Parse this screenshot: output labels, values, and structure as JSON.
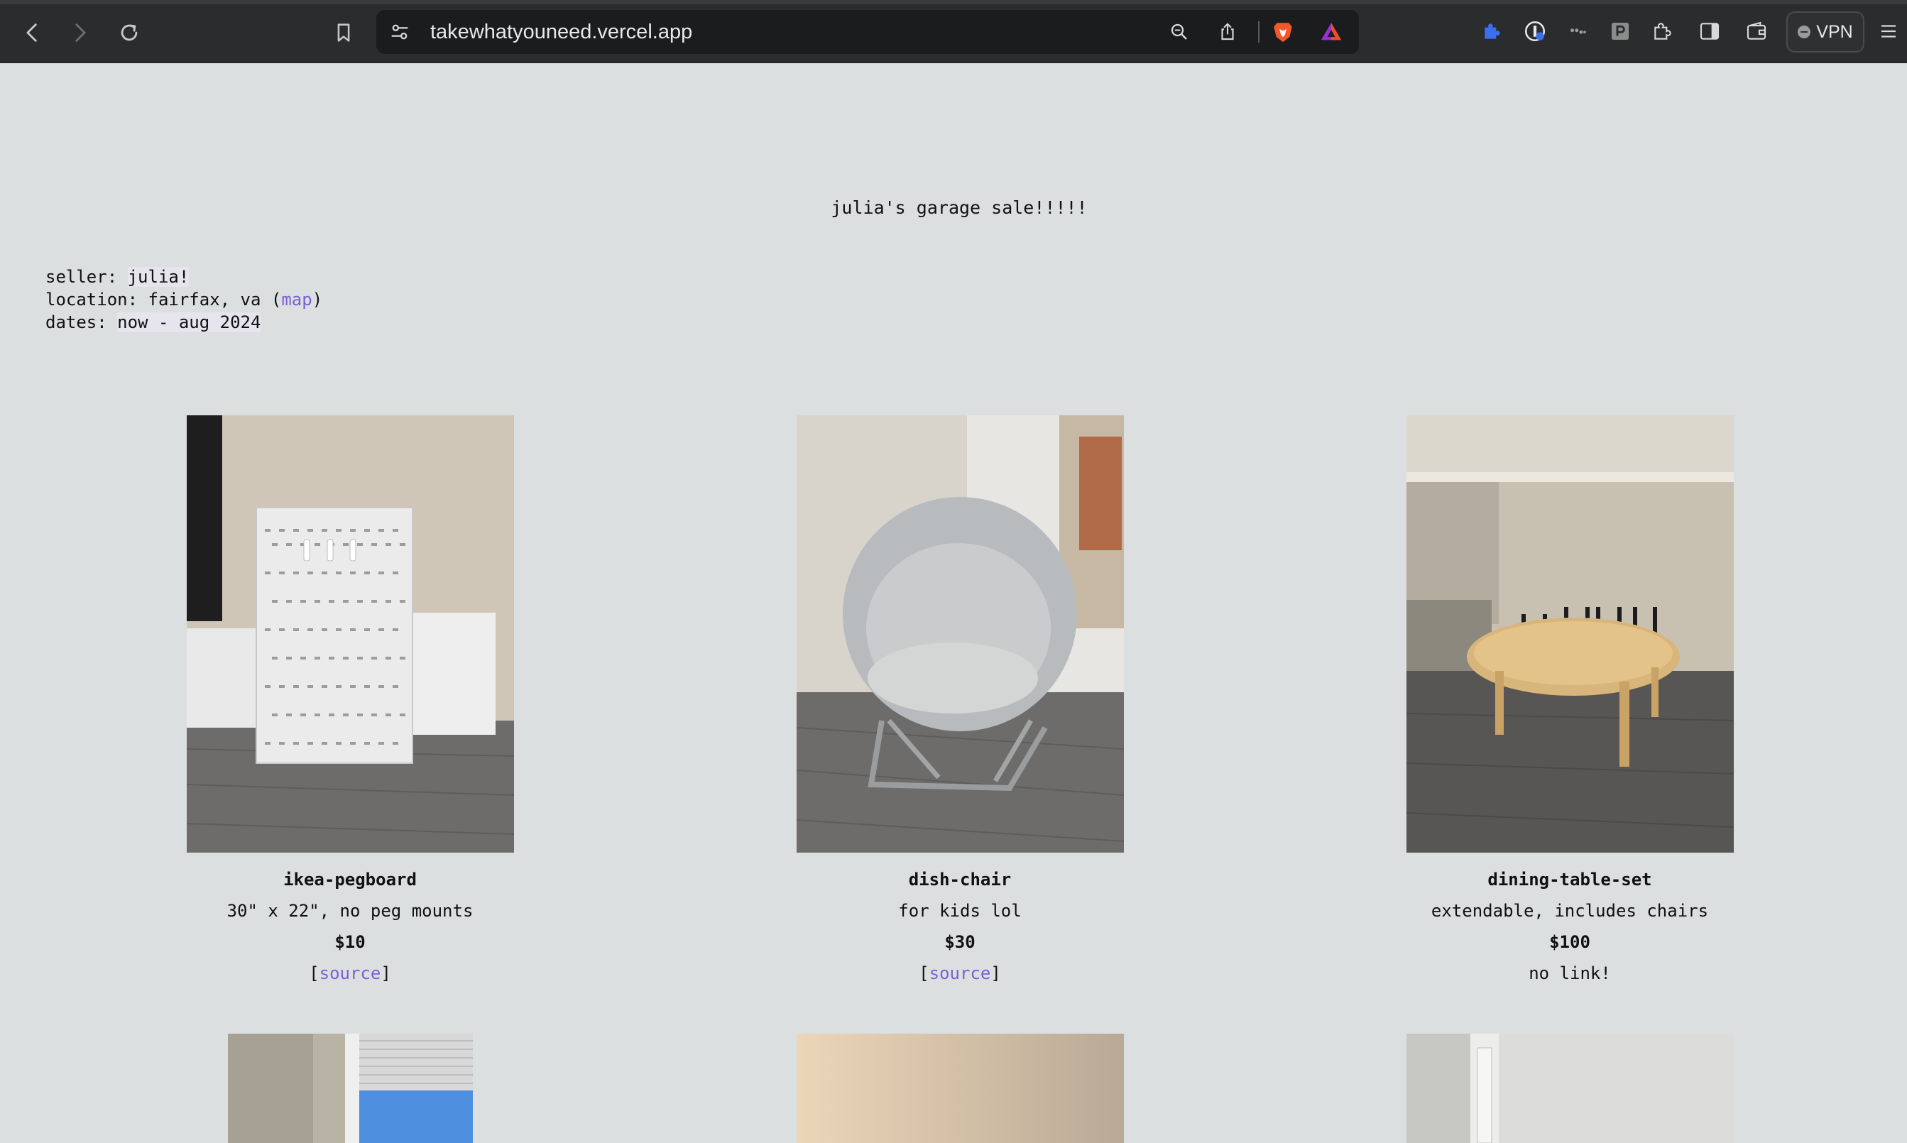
{
  "browser": {
    "url": "takewhatyouneed.vercel.app",
    "vpn_label": "VPN",
    "icons": [
      "back-icon",
      "forward-icon",
      "reload-icon",
      "bookmark-icon",
      "site-settings-icon",
      "zoom-icon",
      "share-icon",
      "brave-shields-icon",
      "brave-rewards-icon",
      "extension-puzzle-icon",
      "password-manager-icon",
      "extension-dots-icon",
      "extension-p-icon",
      "extensions-icon",
      "sidebar-icon",
      "wallet-icon",
      "menu-icon"
    ]
  },
  "page": {
    "title": "julia's garage sale!!!!!",
    "seller_label": "seller: ",
    "seller_value": "julia!",
    "location_label": "location: fairfax, va (",
    "location_link": "map",
    "location_close": ")",
    "dates_label": "dates: ",
    "dates_value": "now - aug 2024"
  },
  "items": [
    {
      "name": "ikea-pegboard",
      "desc": "30\" x 22\", no peg mounts",
      "price": "$10",
      "link_open": "[",
      "link_text": "source",
      "link_close": "]"
    },
    {
      "name": "dish-chair",
      "desc": "for kids lol",
      "price": "$30",
      "link_open": "[",
      "link_text": "source",
      "link_close": "]"
    },
    {
      "name": "dining-table-set",
      "desc": "extendable, includes chairs",
      "price": "$100",
      "link_text": "no link!"
    }
  ]
}
